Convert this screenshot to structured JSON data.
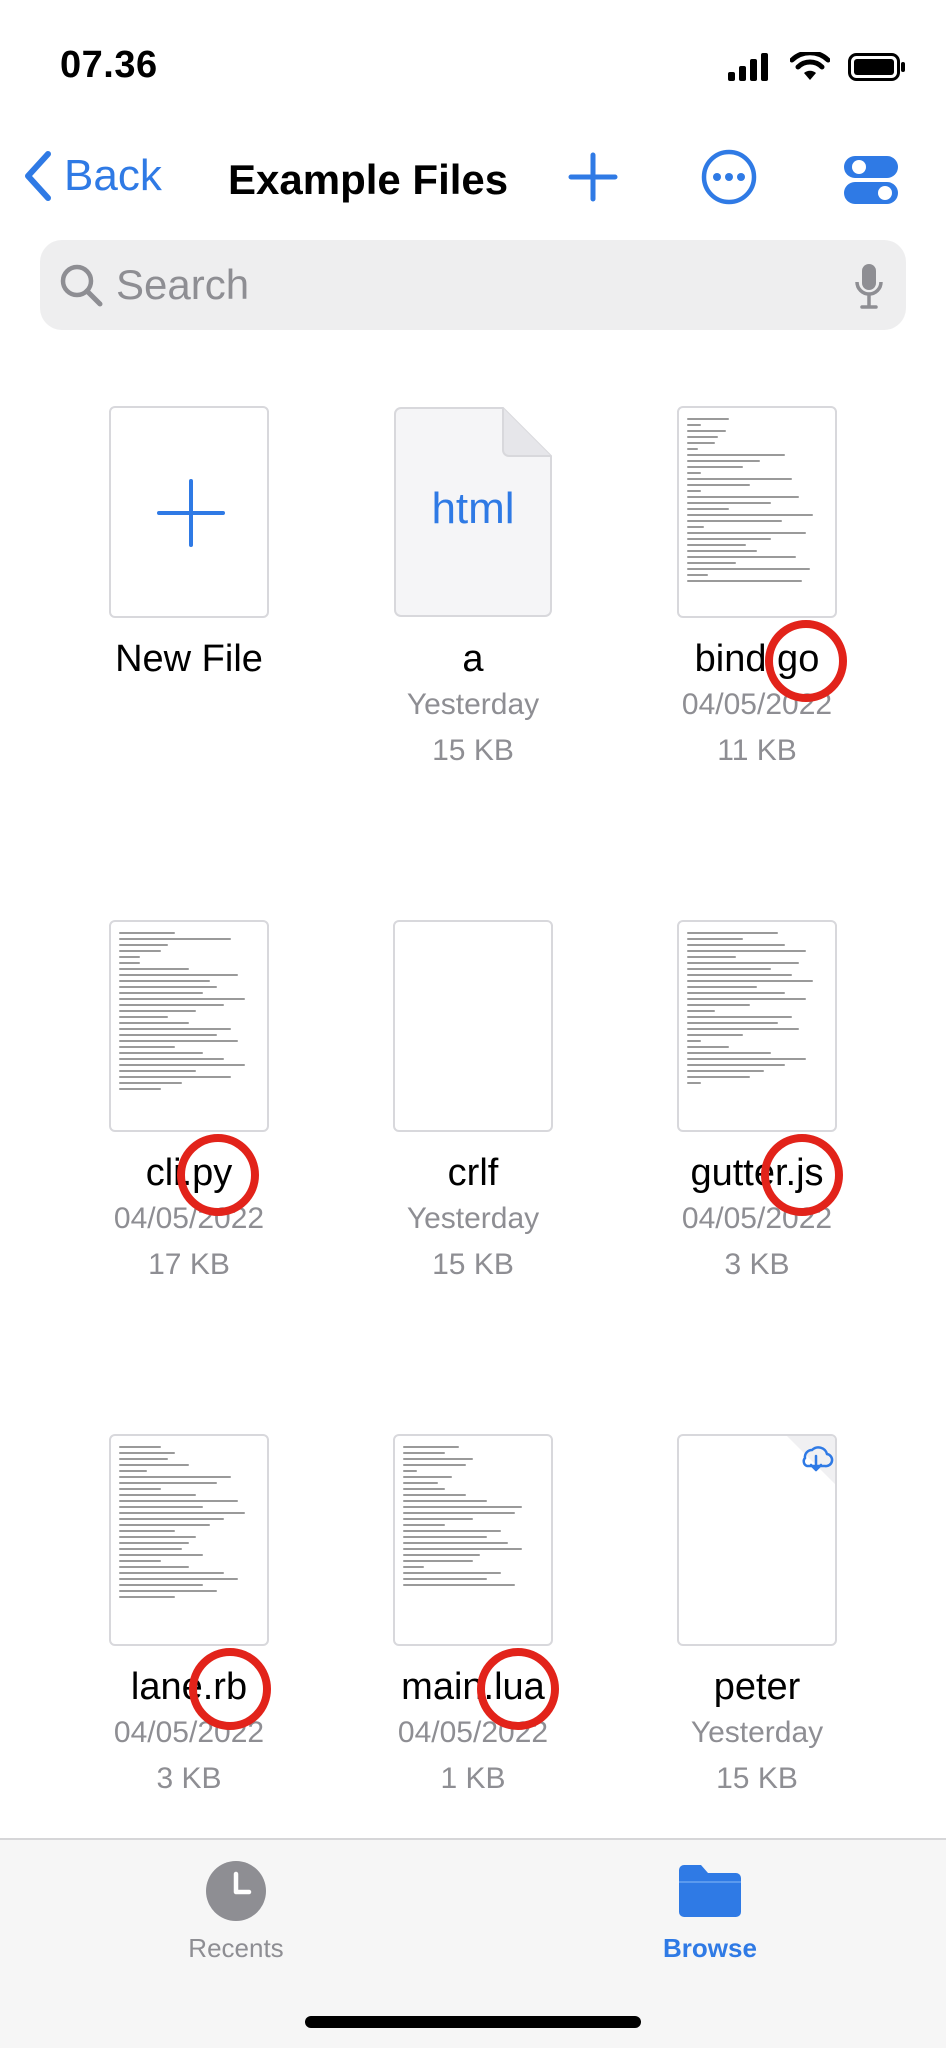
{
  "status": {
    "time": "07.36"
  },
  "nav": {
    "back_label": "Back",
    "title": "Example Files"
  },
  "search": {
    "placeholder": "Search"
  },
  "files": [
    {
      "name": "New File",
      "date": "",
      "size": "",
      "kind": "new"
    },
    {
      "name": "a",
      "date": "Yesterday",
      "size": "15 KB",
      "kind": "html",
      "thumb_label": "html"
    },
    {
      "name": "bind.go",
      "date": "04/05/2022",
      "size": "11 KB",
      "kind": "code"
    },
    {
      "name": "cli.py",
      "date": "04/05/2022",
      "size": "17 KB",
      "kind": "code"
    },
    {
      "name": "crlf",
      "date": "Yesterday",
      "size": "15 KB",
      "kind": "blank"
    },
    {
      "name": "gutter.js",
      "date": "04/05/2022",
      "size": "3 KB",
      "kind": "code"
    },
    {
      "name": "lane.rb",
      "date": "04/05/2022",
      "size": "3 KB",
      "kind": "code"
    },
    {
      "name": "main.lua",
      "date": "04/05/2022",
      "size": "1 KB",
      "kind": "code"
    },
    {
      "name": "peter",
      "date": "Yesterday",
      "size": "15 KB",
      "kind": "cloud"
    }
  ],
  "tabs": {
    "recents_label": "Recents",
    "browse_label": "Browse",
    "active": "Browse"
  },
  "colors": {
    "accent": "#2f7ae5",
    "mark": "#e2231a",
    "secondary_text": "#8e8e93"
  }
}
